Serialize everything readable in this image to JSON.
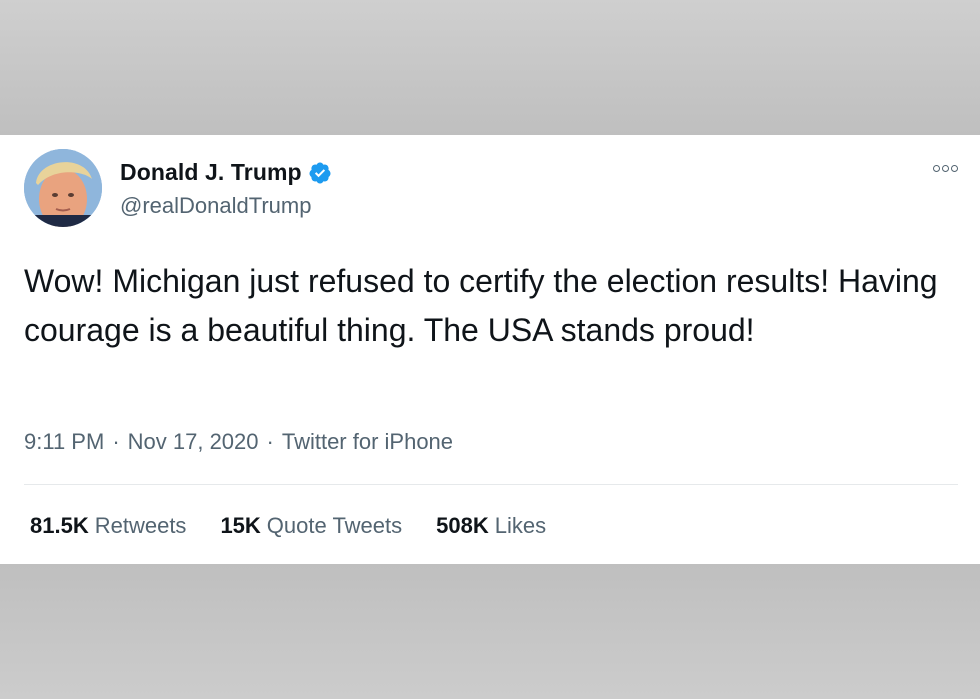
{
  "tweet": {
    "author_name": "Donald J. Trump",
    "author_handle": "@realDonaldTrump",
    "verified": true,
    "text": "Wow! Michigan just refused to certify the election results! Having courage is a beautiful thing. The USA stands proud!",
    "time": "9:11 PM",
    "date": "Nov 17, 2020",
    "source": "Twitter for iPhone",
    "separator": "·",
    "stats": [
      {
        "count": "81.5K",
        "label": "Retweets"
      },
      {
        "count": "15K",
        "label": "Quote Tweets"
      },
      {
        "count": "508K",
        "label": "Likes"
      }
    ]
  },
  "colors": {
    "verified_badge": "#1d9bf0",
    "text_primary": "#0f1419",
    "text_secondary": "#536471"
  },
  "icons": {
    "verified": "verified-badge-icon",
    "more": "more-options-icon"
  }
}
